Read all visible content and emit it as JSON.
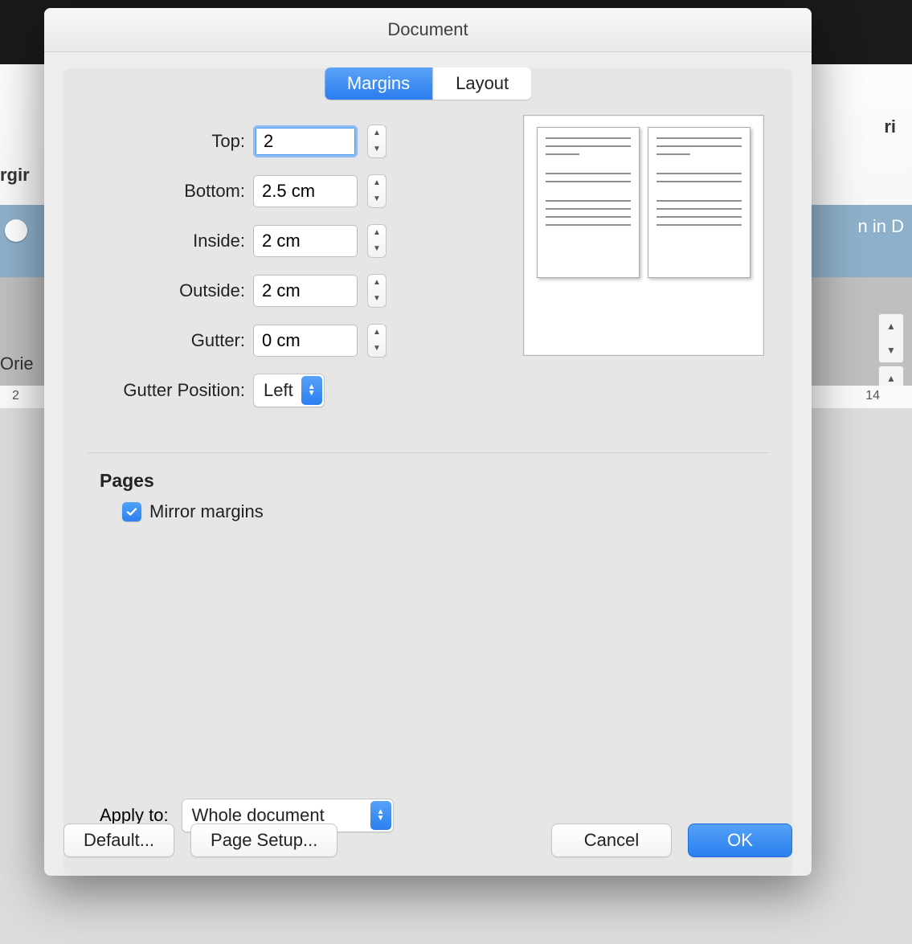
{
  "window": {
    "title": "Document"
  },
  "tabs": {
    "margins": "Margins",
    "layout": "Layout"
  },
  "margins": {
    "top_label": "Top:",
    "top_value": "2",
    "bottom_label": "Bottom:",
    "bottom_value": "2.5 cm",
    "inside_label": "Inside:",
    "inside_value": "2 cm",
    "outside_label": "Outside:",
    "outside_value": "2 cm",
    "gutter_label": "Gutter:",
    "gutter_value": "0 cm",
    "gutter_position_label": "Gutter Position:",
    "gutter_position_value": "Left"
  },
  "pages": {
    "heading": "Pages",
    "mirror_label": "Mirror margins",
    "mirror_checked": true
  },
  "apply": {
    "label": "Apply to:",
    "value": "Whole document"
  },
  "buttons": {
    "default": "Default...",
    "page_setup": "Page Setup...",
    "cancel": "Cancel",
    "ok": "OK"
  },
  "background": {
    "text_right_top": "ri",
    "text_left_mid": "rgir",
    "text_right_mid": "n in D",
    "text_left_lower": "Orie",
    "ruler_left": "2",
    "ruler_right": "14"
  }
}
